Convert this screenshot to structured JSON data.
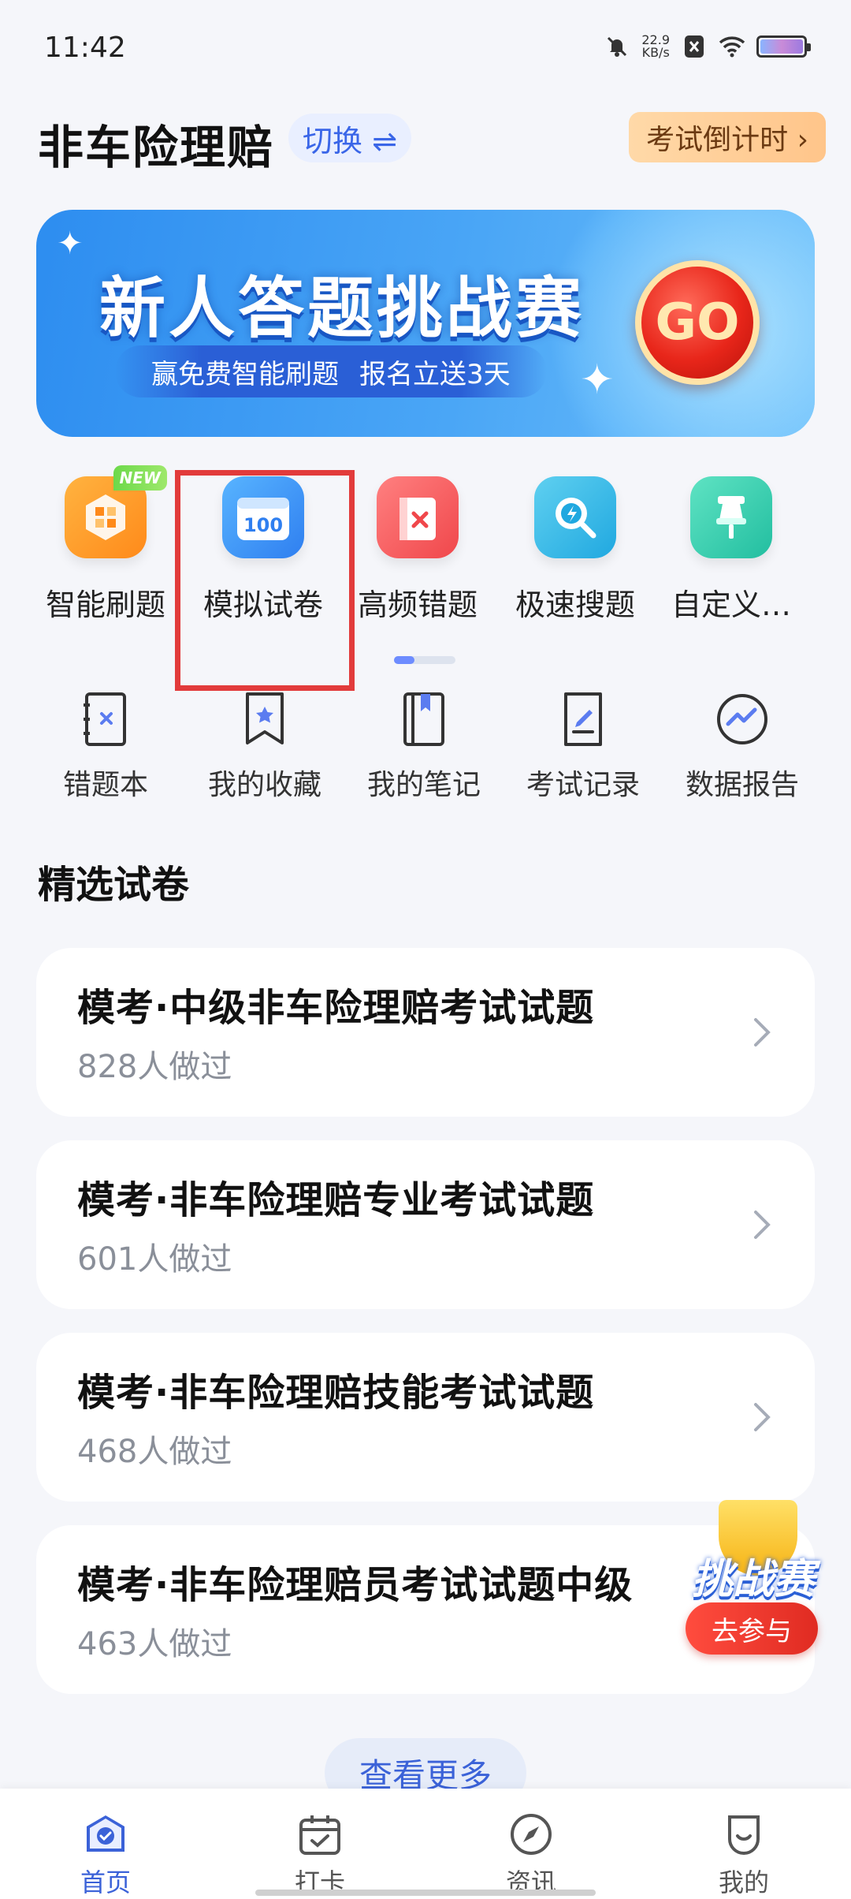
{
  "status_bar": {
    "time": "11:42",
    "net_speed_value": "22.9",
    "net_speed_unit": "KB/s"
  },
  "header": {
    "title": "非车险理赔",
    "switch_label": "切换 ⇌",
    "countdown_label": "考试倒计时 ›"
  },
  "banner": {
    "title": "新人答题挑战赛",
    "sub_left": "赢免费智能刷题",
    "sub_right": "报名立送3天",
    "go_label": "GO"
  },
  "features": [
    {
      "label": "智能刷题",
      "icon": "smart-practice-icon",
      "badge": "NEW"
    },
    {
      "label": "模拟试卷",
      "icon": "mock-paper-icon",
      "icon_text": "100"
    },
    {
      "label": "高频错题",
      "icon": "frequent-mistakes-icon"
    },
    {
      "label": "极速搜题",
      "icon": "quick-search-icon"
    },
    {
      "label": "自定义…",
      "icon": "custom-pin-icon"
    }
  ],
  "tools": [
    {
      "label": "错题本",
      "icon": "mistake-book-icon"
    },
    {
      "label": "我的收藏",
      "icon": "bookmark-icon"
    },
    {
      "label": "我的笔记",
      "icon": "notes-icon"
    },
    {
      "label": "考试记录",
      "icon": "exam-record-icon"
    },
    {
      "label": "数据报告",
      "icon": "data-report-icon"
    }
  ],
  "section": {
    "title": "精选试卷"
  },
  "papers": [
    {
      "title": "模考·中级非车险理赔考试试题",
      "count": "828人做过"
    },
    {
      "title": "模考·非车险理赔专业考试试题",
      "count": "601人做过"
    },
    {
      "title": "模考·非车险理赔技能考试试题",
      "count": "468人做过"
    },
    {
      "title": "模考·非车险理赔员考试试题中级",
      "count": "463人做过"
    }
  ],
  "float_challenge": {
    "title": "挑战赛",
    "button": "去参与"
  },
  "more_button": "查看更多",
  "bottom_nav": [
    {
      "label": "首页",
      "icon": "home-icon",
      "active": true
    },
    {
      "label": "打卡",
      "icon": "calendar-check-icon",
      "active": false
    },
    {
      "label": "资讯",
      "icon": "compass-icon",
      "active": false
    },
    {
      "label": "我的",
      "icon": "profile-icon",
      "active": false
    }
  ],
  "colors": {
    "accent": "#3b62d8",
    "highlight_box": "#e23b3b",
    "go_red": "#e8261a"
  }
}
